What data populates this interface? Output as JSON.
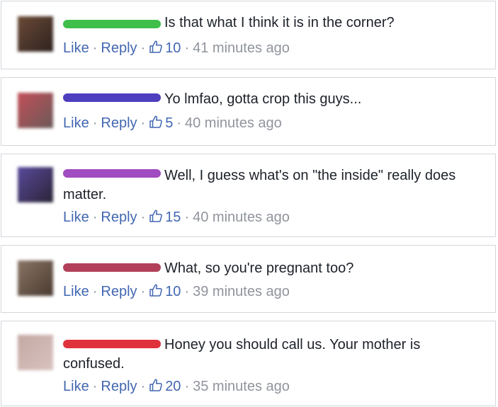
{
  "actions": {
    "like_label": "Like",
    "reply_label": "Reply",
    "separator": "·"
  },
  "comments": [
    {
      "name_color": "#3fbf4a",
      "avatar_colors": [
        "#6b4a36",
        "#2e2220"
      ],
      "text": "Is that what I think it is in the corner?",
      "likes": "10",
      "time": "41 minutes ago"
    },
    {
      "name_color": "#4e3fbf",
      "avatar_colors": [
        "#c24f57",
        "#6b5a5a"
      ],
      "text": "Yo lmfao, gotta crop this guys...",
      "likes": "5",
      "time": "40 minutes ago"
    },
    {
      "name_color": "#a14cc0",
      "avatar_colors": [
        "#5a4a9c",
        "#2a2436"
      ],
      "text": "Well, I guess what's on \"the inside\" really does matter.",
      "likes": "15",
      "time": "40 minutes ago"
    },
    {
      "name_color": "#b2405a",
      "avatar_colors": [
        "#8a7565",
        "#4a3a30"
      ],
      "text": "What, so you're pregnant too?",
      "likes": "10",
      "time": "39 minutes ago"
    },
    {
      "name_color": "#e0323c",
      "avatar_colors": [
        "#c4a9a3",
        "#d8c2bf"
      ],
      "text": "Honey you should call us. Your mother is confused.",
      "likes": "20",
      "time": "35 minutes ago"
    }
  ]
}
